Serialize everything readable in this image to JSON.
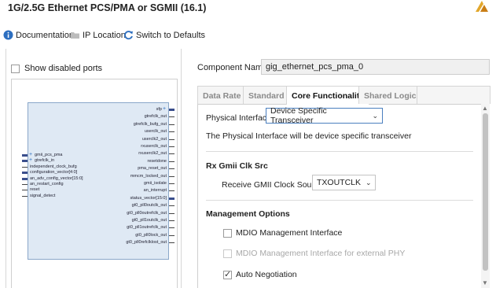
{
  "window": {
    "title": "1G/2.5G Ethernet PCS/PMA or SGMII (16.1)"
  },
  "toolbar": {
    "documentation": "Documentation",
    "ip_location": "IP Location",
    "switch_defaults": "Switch to Defaults"
  },
  "left": {
    "show_disabled": "Show disabled ports",
    "show_disabled_checked": false,
    "symbol": {
      "left_ports": [
        {
          "label": "gmii_pcs_pma",
          "bus": true,
          "plus": true
        },
        {
          "label": "gtrefclk_in",
          "bus": true,
          "plus": true
        },
        {
          "label": "independent_clock_bufg",
          "bus": false
        },
        {
          "label": "configuration_vector[4:0]",
          "bus": true
        },
        {
          "label": "an_adv_config_vector[15:0]",
          "bus": true
        },
        {
          "label": "an_restart_config",
          "bus": false
        },
        {
          "label": "reset",
          "bus": false
        },
        {
          "label": "signal_detect",
          "bus": false
        }
      ],
      "right_ports": [
        {
          "label": "sfp",
          "bus": true,
          "plus": true
        },
        {
          "label": "gtrefclk_out",
          "bus": false
        },
        {
          "label": "gtrefclk_bufg_out",
          "bus": false
        },
        {
          "label": "userclk_out",
          "bus": false
        },
        {
          "label": "userclk2_out",
          "bus": false
        },
        {
          "label": "rxuserclk_out",
          "bus": false
        },
        {
          "label": "rxuserclk2_out",
          "bus": false
        },
        {
          "label": "resetdone",
          "bus": false
        },
        {
          "label": "pma_reset_out",
          "bus": false
        },
        {
          "label": "mmcm_locked_out",
          "bus": false
        },
        {
          "label": "gmii_isolate",
          "bus": false
        },
        {
          "label": "an_interrupt",
          "bus": false
        },
        {
          "label": "status_vector[15:0]",
          "bus": true
        },
        {
          "label": "gt0_pll0outclk_out",
          "bus": false
        },
        {
          "label": "gt0_pll0outrefclk_out",
          "bus": false
        },
        {
          "label": "gt0_pll1outclk_out",
          "bus": false
        },
        {
          "label": "gt0_pll1outrefclk_out",
          "bus": false
        },
        {
          "label": "gt0_pll0lock_out",
          "bus": false
        },
        {
          "label": "gt0_pll0refclklost_out",
          "bus": false
        }
      ]
    }
  },
  "component": {
    "label": "Component Name",
    "value": "gig_ethernet_pcs_pma_0"
  },
  "tabs": [
    {
      "label": "Data Rate",
      "active": false
    },
    {
      "label": "Standard",
      "active": false
    },
    {
      "label": "Core Functionality",
      "active": true
    },
    {
      "label": "Shared Logic",
      "active": false
    }
  ],
  "core": {
    "physical_interface_label": "Physical Interface",
    "physical_interface_value": "Device Specific Transceiver",
    "physical_interface_note": "The Physical Interface will be device specific transceiver",
    "rx_gmii_heading": "Rx Gmii Clk Src",
    "receive_clock_label": "Receive GMII Clock Source",
    "receive_clock_value": "TXOUTCLK",
    "management_heading": "Management Options",
    "mdio_label": "MDIO Management Interface",
    "mdio_checked": false,
    "mdio_ext_label": "MDIO Management Interface for external PHY",
    "mdio_ext_checked": false,
    "auto_neg_label": "Auto Negotiation",
    "auto_neg_checked": true
  },
  "colors": {
    "accent": "#4a7fbf",
    "logo": "#e2a72b",
    "block_fill": "#dfe9f4",
    "bus": "#3a4e8c"
  }
}
